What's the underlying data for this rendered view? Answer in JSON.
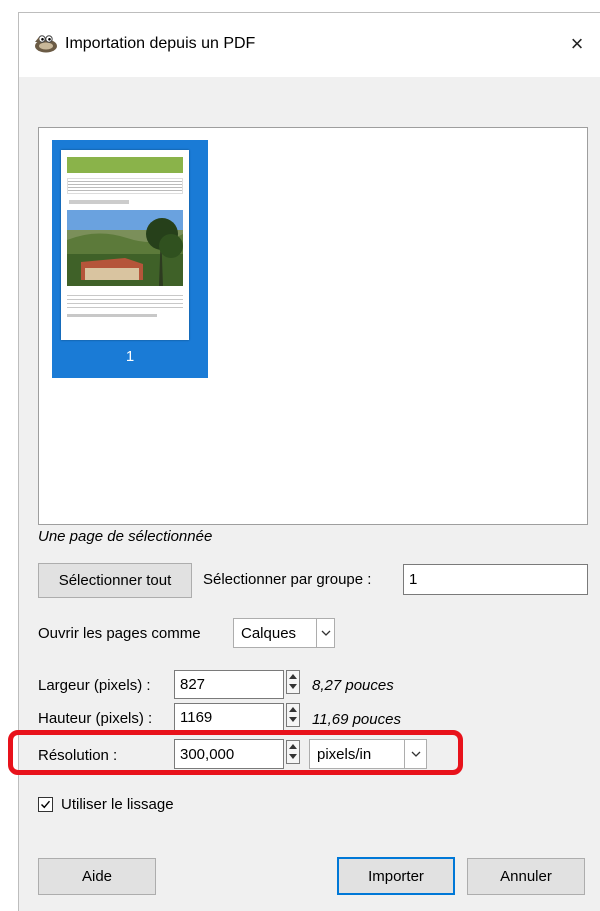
{
  "window": {
    "title": "Importation depuis un PDF",
    "close_symbol": "×"
  },
  "preview": {
    "pages": [
      {
        "number": "1",
        "selected": true
      }
    ],
    "selection_status": "Une page de sélectionnée"
  },
  "select": {
    "all_button": "Sélectionner tout",
    "by_group_label": "Sélectionner par groupe :",
    "by_group_value": "1"
  },
  "open_as": {
    "label": "Ouvrir les pages comme",
    "value": "Calques"
  },
  "width": {
    "label": "Largeur (pixels) :",
    "value": "827",
    "unit_text": "8,27 pouces"
  },
  "height": {
    "label": "Hauteur (pixels) :",
    "value": "1169",
    "unit_text": "11,69 pouces"
  },
  "resolution": {
    "label": "Résolution :",
    "value": "300,000",
    "unit": "pixels/in"
  },
  "antialias": {
    "label": "Utiliser le lissage",
    "checked": true
  },
  "footer": {
    "help_label": "Aide",
    "import_label": "Importer",
    "cancel_label": "Annuler"
  },
  "colors": {
    "selection_blue": "#1a7bd6",
    "highlight_red": "#e8121b",
    "focus_blue": "#0078d7"
  },
  "icons": {
    "app": "gimp-wilber-icon",
    "close": "close-icon",
    "spin": "spin-arrows-icon",
    "dropdown": "chevron-down-icon",
    "check": "checkmark-icon"
  }
}
